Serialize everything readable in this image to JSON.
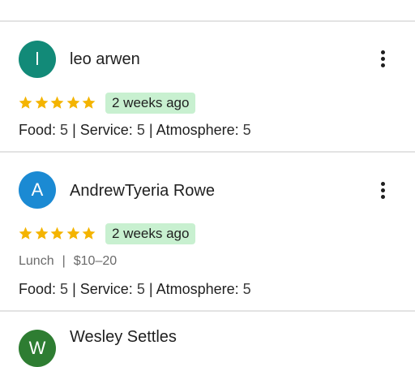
{
  "colors": {
    "divider": "#e3e3e3",
    "star": "#f4b400",
    "badge_bg": "#c8f0d0",
    "avatar_l": "#128a78",
    "avatar_a": "#1b8ad3",
    "avatar_w": "#2e7d32"
  },
  "reviews": [
    {
      "avatar_letter": "l",
      "avatar_color": "#128a78",
      "name": "leo arwen",
      "stars": 5,
      "time": "2 weeks ago",
      "ratings": [
        {
          "label": "Food:",
          "value": "5"
        },
        {
          "label": "Service:",
          "value": "5"
        },
        {
          "label": "Atmosphere:",
          "value": "5"
        }
      ]
    },
    {
      "avatar_letter": "A",
      "avatar_color": "#1b8ad3",
      "name": "AndrewTyeria Rowe",
      "stars": 5,
      "time": "2 weeks ago",
      "meal": "Lunch",
      "meta_separator": "|",
      "price": "$10–20",
      "ratings": [
        {
          "label": "Food:",
          "value": "5"
        },
        {
          "label": "Service:",
          "value": "5"
        },
        {
          "label": "Atmosphere:",
          "value": "5"
        }
      ]
    },
    {
      "avatar_letter": "W",
      "avatar_color": "#2e7d32",
      "name": "Wesley Settles"
    }
  ],
  "rating_separator": "|",
  "icons": {
    "more": "more-vert-icon",
    "star": "star-icon"
  }
}
